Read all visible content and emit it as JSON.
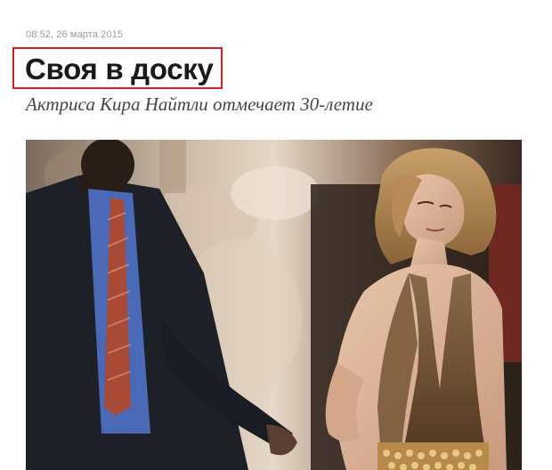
{
  "article": {
    "timestamp": "08:52, 26 марта 2015",
    "headline": "Своя в доску",
    "subtitle": "Актриса Кира Найтли отмечает 30-летие",
    "photo_description": "Keira Knightley in a bronze halter dress on the red carpet with a security guard in a suit behind her"
  },
  "colors": {
    "highlight_border": "#d62020",
    "headline": "#1a1a1a",
    "timestamp": "#9a9a9a",
    "subtitle": "#444444"
  }
}
